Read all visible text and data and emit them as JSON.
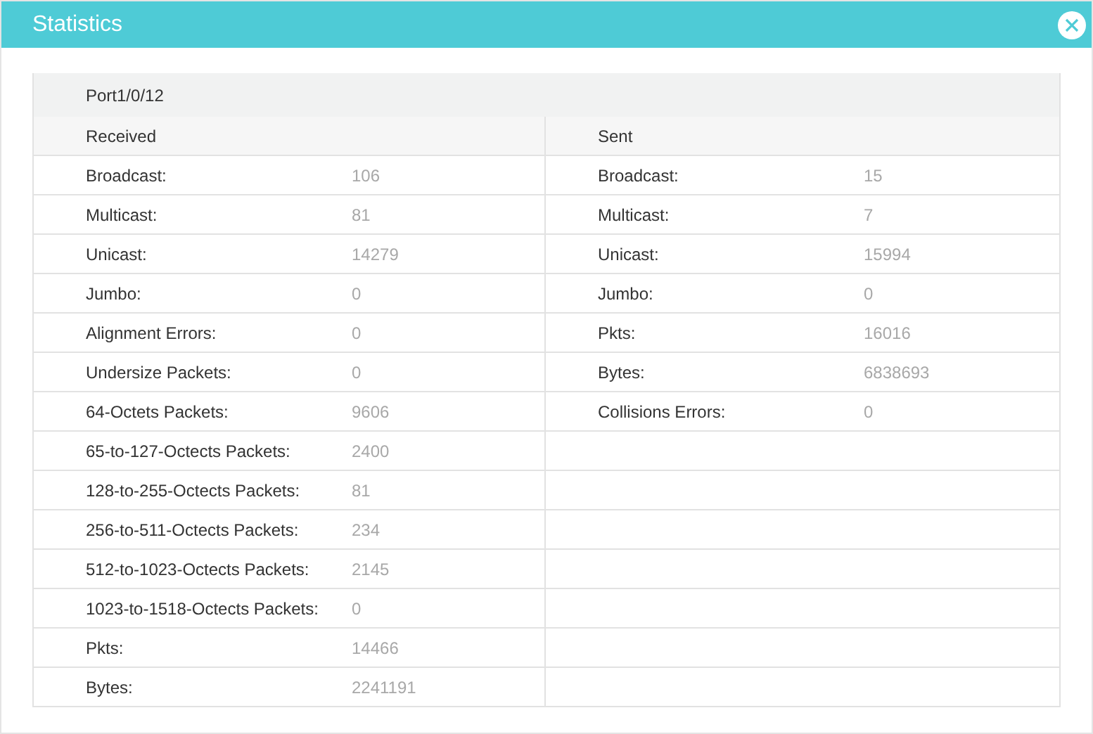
{
  "window": {
    "title": "Statistics"
  },
  "port": "Port1/0/12",
  "received": {
    "heading": "Received",
    "rows": [
      {
        "label": "Broadcast:",
        "value": "106"
      },
      {
        "label": "Multicast:",
        "value": "81"
      },
      {
        "label": "Unicast:",
        "value": "14279"
      },
      {
        "label": "Jumbo:",
        "value": "0"
      },
      {
        "label": "Alignment Errors:",
        "value": "0"
      },
      {
        "label": "Undersize Packets:",
        "value": "0"
      },
      {
        "label": "64-Octets Packets:",
        "value": "9606"
      },
      {
        "label": "65-to-127-Octects Packets:",
        "value": "2400"
      },
      {
        "label": "128-to-255-Octects Packets:",
        "value": "81"
      },
      {
        "label": "256-to-511-Octects Packets:",
        "value": "234"
      },
      {
        "label": "512-to-1023-Octects Packets:",
        "value": "2145"
      },
      {
        "label": "1023-to-1518-Octects Packets:",
        "value": "0"
      },
      {
        "label": "Pkts:",
        "value": "14466"
      },
      {
        "label": "Bytes:",
        "value": "2241191"
      }
    ]
  },
  "sent": {
    "heading": "Sent",
    "rows": [
      {
        "label": "Broadcast:",
        "value": "15"
      },
      {
        "label": "Multicast:",
        "value": "7"
      },
      {
        "label": "Unicast:",
        "value": "15994"
      },
      {
        "label": "Jumbo:",
        "value": "0"
      },
      {
        "label": "Pkts:",
        "value": "16016"
      },
      {
        "label": "Bytes:",
        "value": "6838693"
      },
      {
        "label": "Collisions Errors:",
        "value": "0"
      }
    ]
  }
}
